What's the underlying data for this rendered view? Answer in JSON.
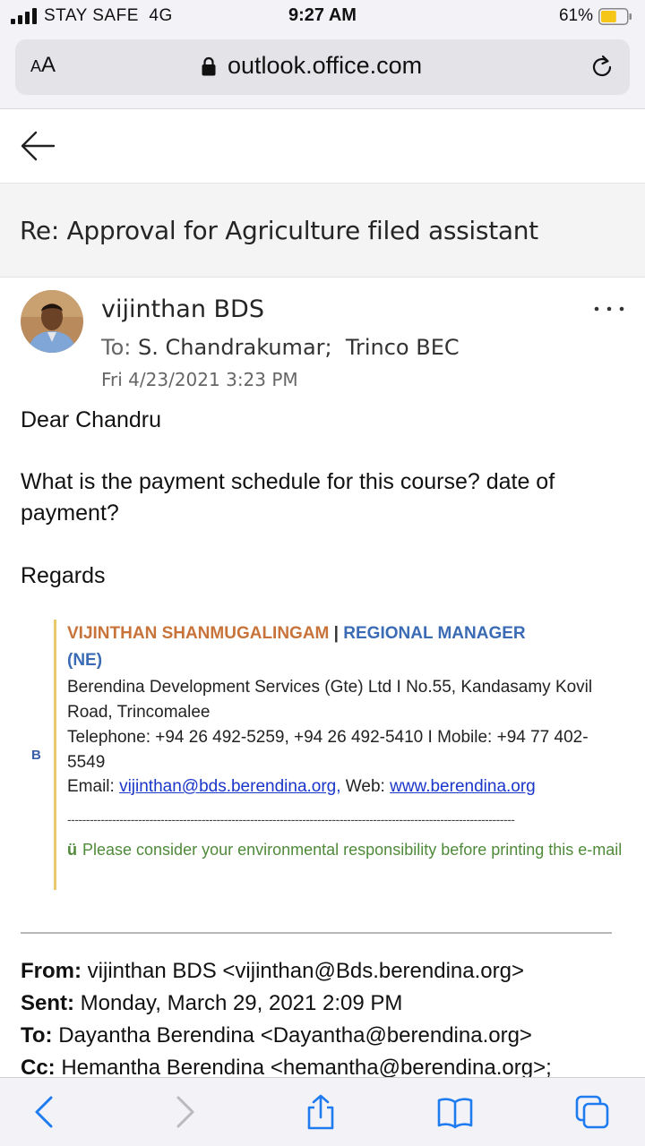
{
  "status_bar": {
    "carrier": "STAY SAFE  4G",
    "time": "9:27 AM",
    "battery_percent": "61%",
    "battery_level": 0.61
  },
  "browser": {
    "aa_label": "AA",
    "url": "outlook.office.com"
  },
  "email": {
    "subject": "Re: Approval for Agriculture filed assistant",
    "sender": "vijinthan BDS",
    "to_label": "To:",
    "recipients": "S. Chandrakumar;  Trinco BEC",
    "date": "Fri 4/23/2021 3:23 PM",
    "greeting": "Dear Chandru",
    "question": "What is the payment schedule for this course? date of payment?",
    "regards": "Regards"
  },
  "signature": {
    "logo_text": "B",
    "name": "VIJINTHAN SHANMUGALINGAM",
    "separator": " | ",
    "title": "REGIONAL MANAGER",
    "region": "(NE)",
    "org": "Berendina Development Services (Gte) Ltd I No.55, Kandasamy Kovil Road, Trincomalee",
    "phone": "Telephone: +94 26 492-5259, +94 26 492-5410 I Mobile: +94 77 402-5549",
    "email_label": "Email: ",
    "email": "vijinthan@bds.berendina.org,",
    "web_label": " Web: ",
    "web": "www.berendina.org",
    "dashes": "------------------------------------------------------------------------------------------------------------------------",
    "env_glyph": "ü",
    "env_note": "Please consider your environmental responsibility before printing this e-mail"
  },
  "quoted_headers": {
    "from_label": "From:",
    "from_value": " vijinthan BDS <vijinthan@Bds.berendina.org>",
    "sent_label": "Sent:",
    "sent_value": " Monday, March 29, 2021 2:09 PM",
    "to_label": "To:",
    "to_value": " Dayantha Berendina <Dayantha@berendina.org>",
    "cc_label": "Cc:",
    "cc_value": " Hemantha Berendina <hemantha@berendina.org>;"
  },
  "icons": {
    "signal": "signal-icon",
    "battery": "battery-icon",
    "lock": "lock-icon",
    "reload": "reload-icon",
    "back": "back-arrow-icon",
    "more": "more-options-icon",
    "tb_back": "chevron-left-icon",
    "tb_forward": "chevron-right-icon",
    "share": "share-icon",
    "bookmarks": "book-icon",
    "tabs": "tabs-icon"
  },
  "colors": {
    "ios_blue": "#1f7cf0",
    "battery_yellow": "#f5c518",
    "sig_orange": "#c8733a",
    "sig_blue": "#3a6bb4",
    "sig_green": "#4f8a3a",
    "link_blue": "#1a35c9"
  }
}
